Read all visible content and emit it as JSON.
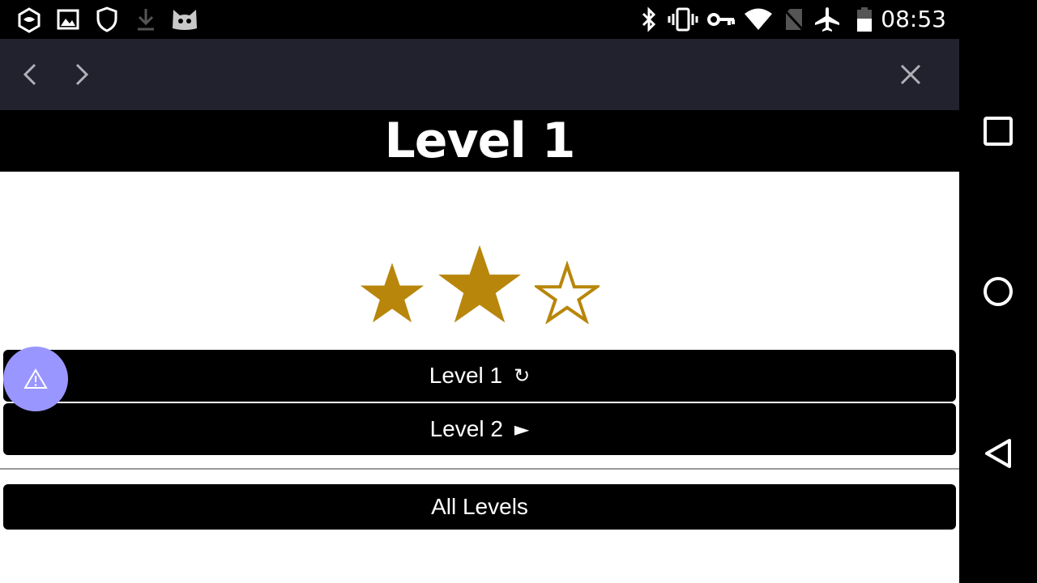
{
  "status_bar": {
    "time": "08:53",
    "left_icons": [
      "app-hex-icon",
      "image-icon",
      "shield-icon",
      "download-icon",
      "cat-icon"
    ],
    "right_icons": [
      "bluetooth-icon",
      "vibrate-icon",
      "vpn-key-icon",
      "wifi-icon",
      "no-sim-icon",
      "airplane-icon",
      "battery-icon"
    ]
  },
  "page": {
    "title": "Level 1",
    "stars": {
      "earned": 2,
      "total": 3
    },
    "star_color": "#b8860b"
  },
  "menu": {
    "replay_label": "Level 1",
    "replay_symbol": "↻",
    "next_label": "Level 2",
    "next_symbol": "►",
    "all_levels_label": "All Levels"
  },
  "fab": {
    "icon": "warning-icon",
    "color": "#9a96ff"
  },
  "colors": {
    "toolbar_bg": "#22222f",
    "title_bg": "#000000",
    "button_bg": "#000000"
  }
}
